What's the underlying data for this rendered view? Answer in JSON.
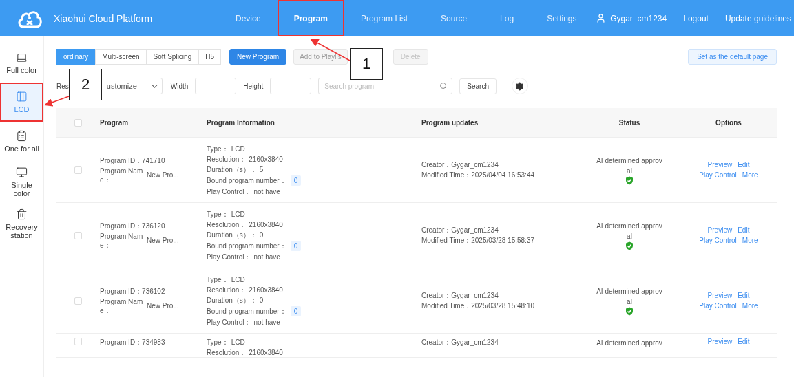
{
  "header": {
    "title": "Xiaohui Cloud Platform",
    "nav": [
      {
        "label": "Device",
        "selected": false,
        "highlighted": false
      },
      {
        "label": "Program",
        "selected": true,
        "highlighted": true
      },
      {
        "label": "Program List",
        "selected": false,
        "highlighted": false
      },
      {
        "label": "Source",
        "selected": false,
        "highlighted": false
      },
      {
        "label": "Log",
        "selected": false,
        "highlighted": false
      },
      {
        "label": "Settings",
        "selected": false,
        "highlighted": false
      }
    ],
    "user": "Gygar_cm1234",
    "links": [
      "Logout",
      "Update guidelines"
    ]
  },
  "sidebar": {
    "items": [
      {
        "label": "Full color",
        "selected": false,
        "highlighted": false
      },
      {
        "label": "LCD",
        "selected": true,
        "highlighted": true
      },
      {
        "label": "One for all",
        "selected": false,
        "highlighted": false
      },
      {
        "label": "Single color",
        "selected": false,
        "highlighted": false
      },
      {
        "label": "Recovery station",
        "selected": false,
        "highlighted": false
      }
    ]
  },
  "toolbar": {
    "tabs": [
      {
        "label": "ordinary",
        "selected": true
      },
      {
        "label": "Multi-screen",
        "selected": false
      },
      {
        "label": "Soft Splicing",
        "selected": false
      },
      {
        "label": "H5",
        "selected": false
      }
    ],
    "buttons": [
      {
        "label": "New Program",
        "kind": "primary"
      },
      {
        "label": "Add to Playlis",
        "kind": "disabled"
      },
      {
        "label": "Delete",
        "kind": "disabled"
      }
    ],
    "default_button": "Set as the default page"
  },
  "filters": {
    "resolution_label": "Res",
    "resolution_value": "ustomize",
    "width_label": "Width",
    "height_label": "Height",
    "search_placeholder": "Search program",
    "search_button": "Search"
  },
  "table": {
    "header_checked": false,
    "columns": [
      "Program",
      "Program Information",
      "Program updates",
      "Status",
      "Options"
    ],
    "rows": [
      {
        "checked": false,
        "program_id": "Program ID：741710",
        "name_label": "Program Name：",
        "name": "New Pro...",
        "info": [
          {
            "label": "Type：",
            "value": "LCD",
            "kind": "text"
          },
          {
            "label": "Resolution：",
            "value": "2160x3840",
            "kind": "text"
          },
          {
            "label": "Duration（s）：",
            "value": "5",
            "kind": "text"
          },
          {
            "label": "Bound program number：",
            "value": "0",
            "kind": "badge"
          },
          {
            "label": "Play Control：",
            "value": "not have",
            "kind": "text"
          }
        ],
        "creator": "Creator：Gygar_cm1234",
        "modified": "Modified Time：2025/04/04 16:53:44",
        "status": "AI determined approval",
        "approved": true,
        "options": [
          "Preview",
          "Edit",
          "Play Control",
          "More"
        ]
      },
      {
        "checked": false,
        "program_id": "Program ID：736120",
        "name_label": "Program Name：",
        "name": "New Pro...",
        "info": [
          {
            "label": "Type：",
            "value": "LCD",
            "kind": "text"
          },
          {
            "label": "Resolution：",
            "value": "2160x3840",
            "kind": "text"
          },
          {
            "label": "Duration（s）：",
            "value": "0",
            "kind": "text"
          },
          {
            "label": "Bound program number：",
            "value": "0",
            "kind": "badge"
          },
          {
            "label": "Play Control：",
            "value": "not have",
            "kind": "text"
          }
        ],
        "creator": "Creator：Gygar_cm1234",
        "modified": "Modified Time：2025/03/28 15:58:37",
        "status": "AI determined approval",
        "approved": true,
        "options": [
          "Preview",
          "Edit",
          "Play Control",
          "More"
        ]
      },
      {
        "checked": false,
        "program_id": "Program ID：736102",
        "name_label": "Program Name：",
        "name": "New Pro...",
        "info": [
          {
            "label": "Type：",
            "value": "LCD",
            "kind": "text"
          },
          {
            "label": "Resolution：",
            "value": "2160x3840",
            "kind": "text"
          },
          {
            "label": "Duration（s）：",
            "value": "0",
            "kind": "text"
          },
          {
            "label": "Bound program number：",
            "value": "0",
            "kind": "badge"
          },
          {
            "label": "Play Control：",
            "value": "not have",
            "kind": "text"
          }
        ],
        "creator": "Creator：Gygar_cm1234",
        "modified": "Modified Time：2025/03/28 15:48:10",
        "status": "AI determined approval",
        "approved": true,
        "options": [
          "Preview",
          "Edit",
          "Play Control",
          "More"
        ]
      },
      {
        "checked": false,
        "program_id": "Program ID：734983",
        "info": [
          {
            "label": "Type：",
            "value": "LCD",
            "kind": "text"
          },
          {
            "label": "Resolution：",
            "value": "2160x3840",
            "kind": "text"
          }
        ],
        "creator": "Creator：Gygar_cm1234",
        "status": "AI determined approv",
        "options": [
          "Preview",
          "Edit"
        ]
      }
    ]
  },
  "callouts": [
    "1",
    "2"
  ]
}
